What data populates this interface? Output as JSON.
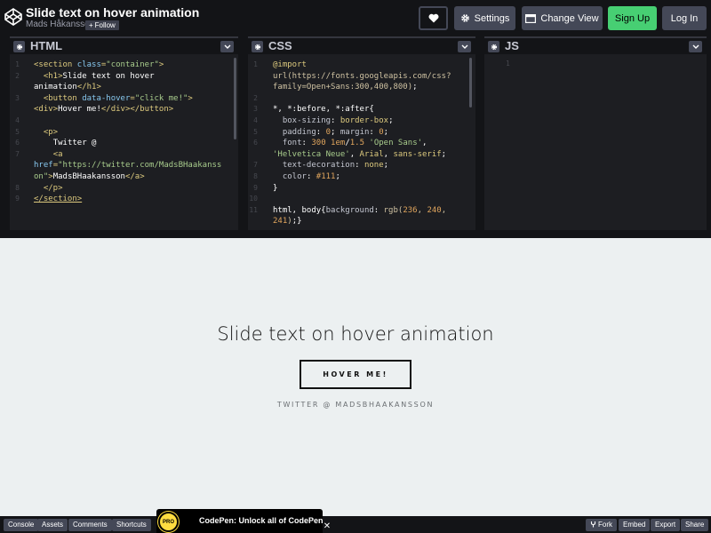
{
  "header": {
    "pen_title": "Slide text on hover animation",
    "author": "Mads Håkansson",
    "follow_label": "Follow",
    "settings_label": "Settings",
    "change_view_label": "Change View",
    "signup_label": "Sign Up",
    "login_label": "Log In"
  },
  "editors": {
    "html": {
      "title": "HTML"
    },
    "css": {
      "title": "CSS"
    },
    "js": {
      "title": "JS",
      "line_number": "1"
    }
  },
  "preview": {
    "title": "Slide text on hover animation",
    "button_label": "HOVER ME!",
    "twitter": "TWITTER @ MADSBHAAKANSSON"
  },
  "footer": {
    "console": "Console",
    "assets": "Assets",
    "comments": "Comments",
    "shortcuts": "Shortcuts",
    "promo_badge": "PRO",
    "promo": "CodePen: Unlock all of CodePen",
    "promo_close": "✕",
    "fork": "Fork",
    "embed": "Embed",
    "export": "Export",
    "share": "Share"
  },
  "colors": {
    "signup": "#47cf73",
    "editor_bg": "#1d1e22",
    "header_bg": "#131417",
    "preview_bg": "#ecf0f1"
  },
  "icons": [
    "codepen-logo-icon",
    "heart-icon",
    "gear-icon",
    "layout-icon",
    "chevron-down-icon",
    "fork-icon",
    "close-icon"
  ]
}
